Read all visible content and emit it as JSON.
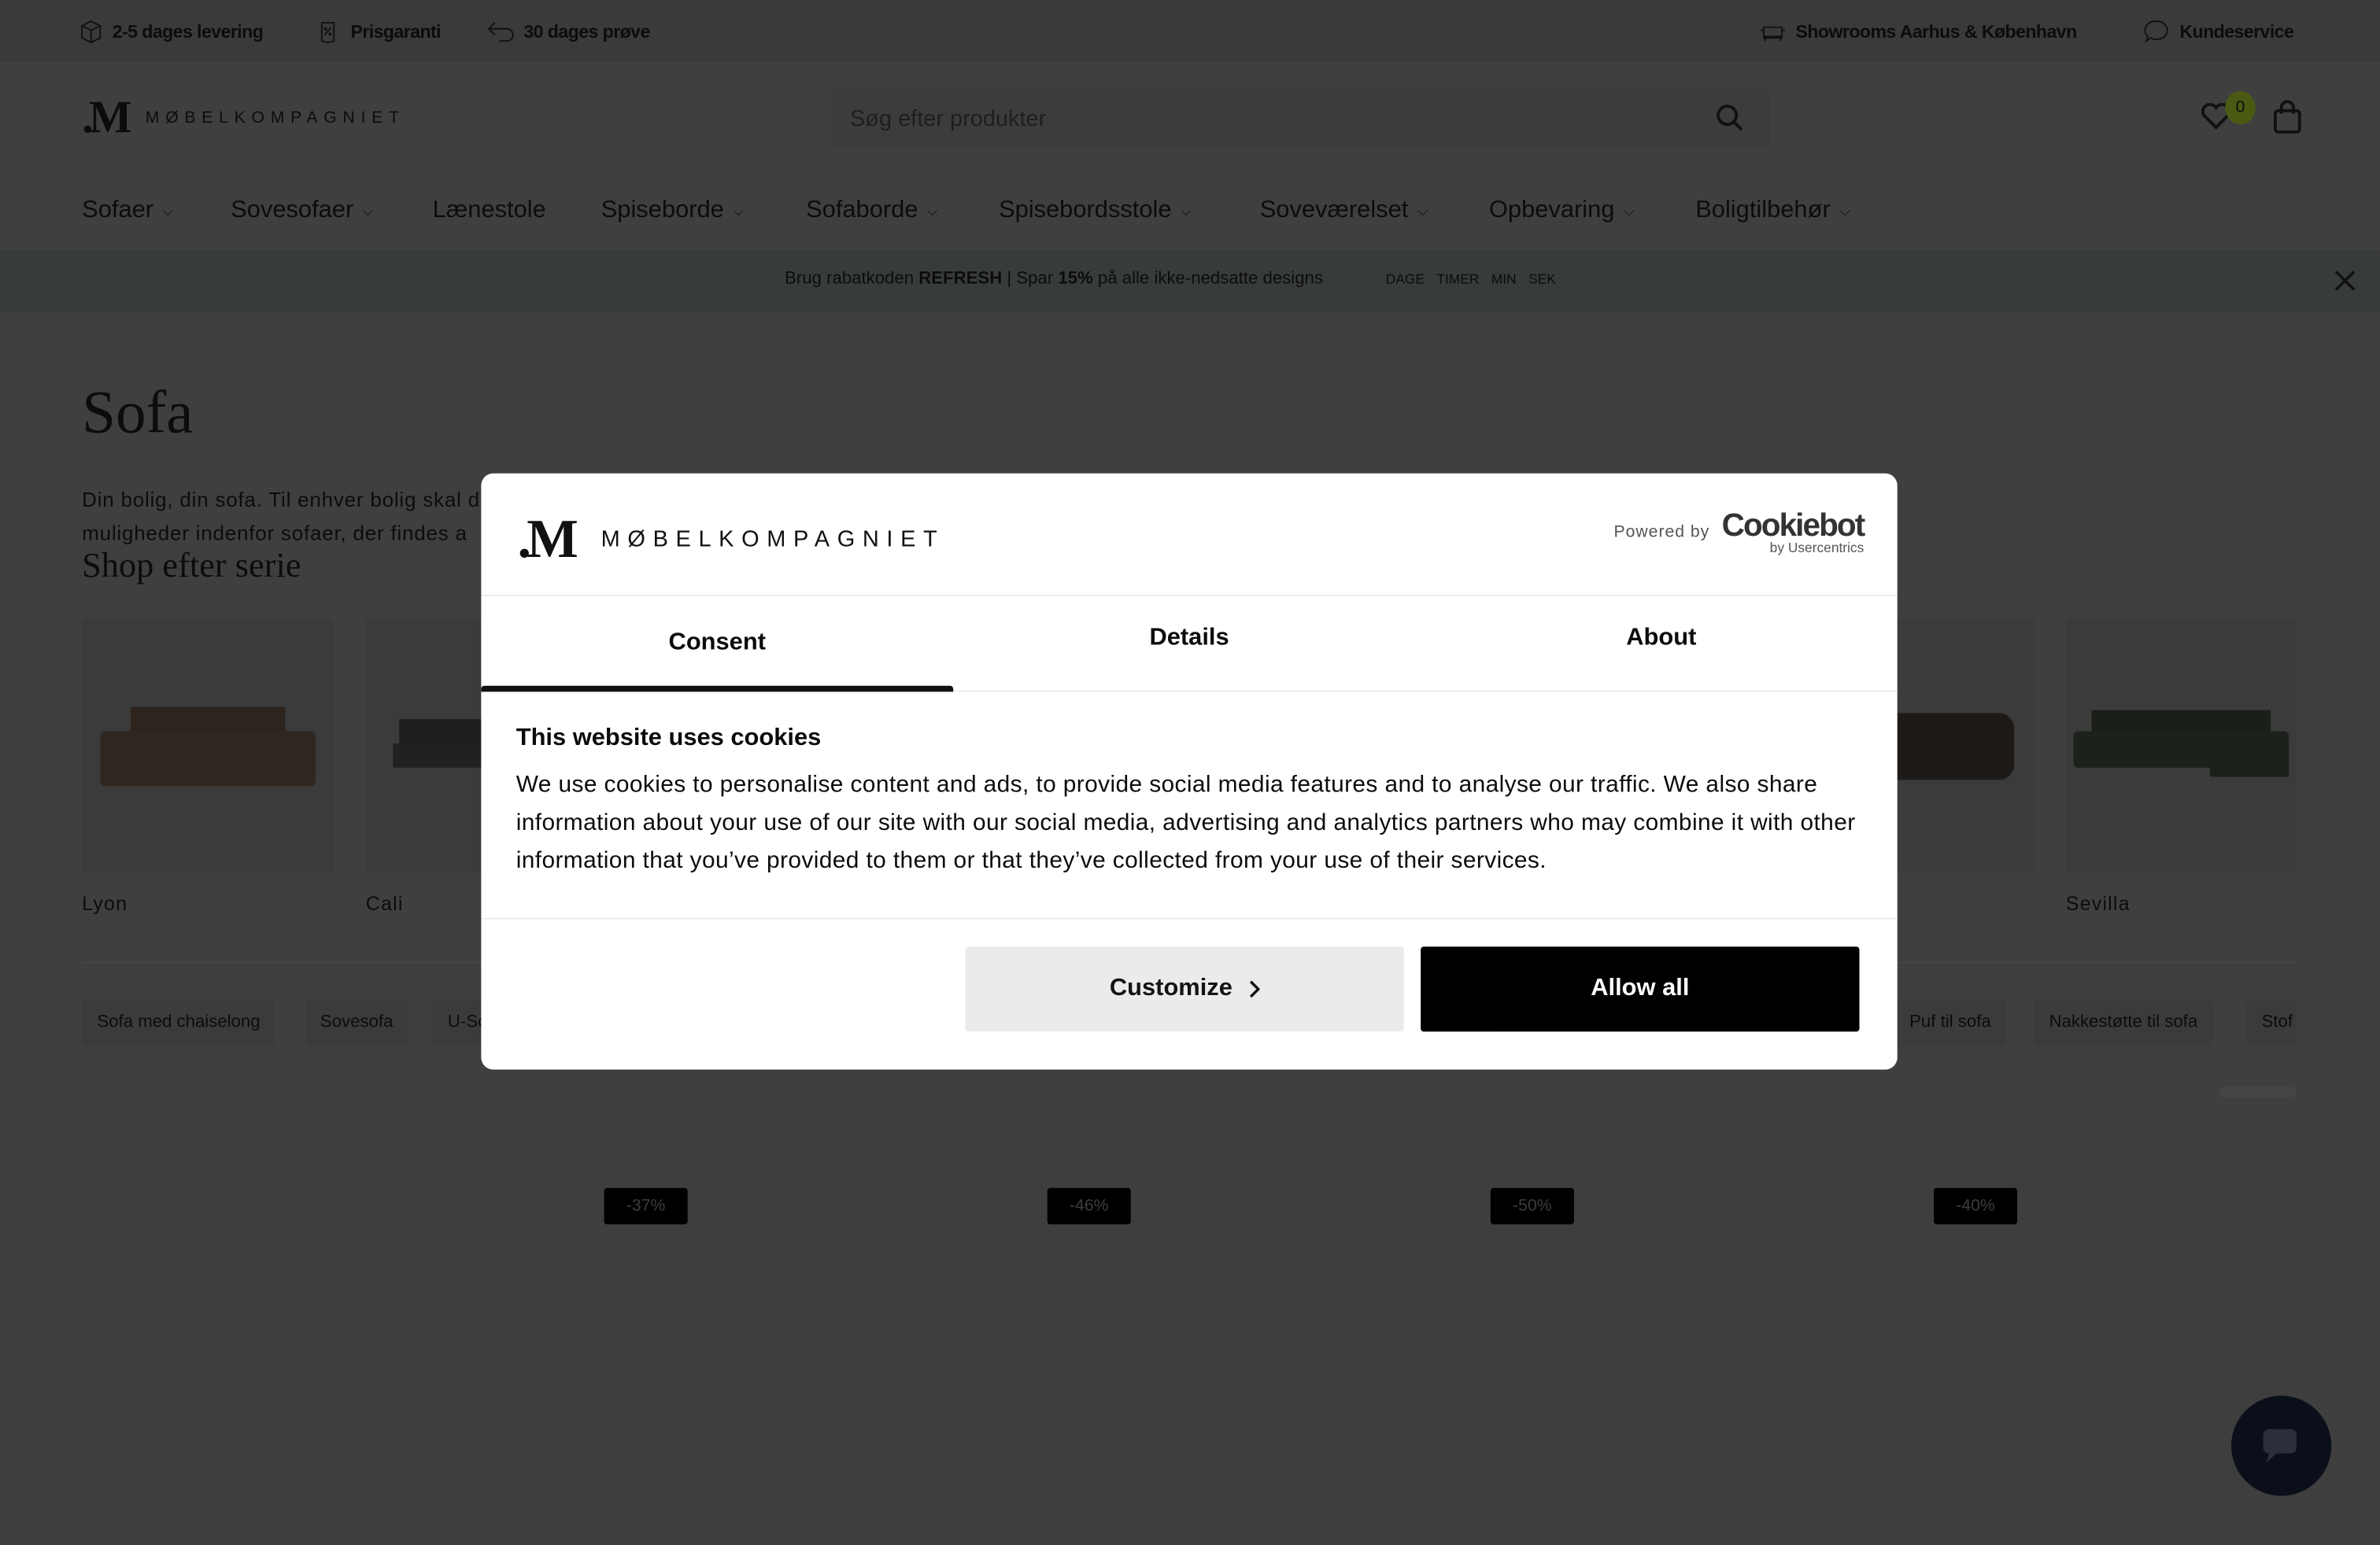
{
  "topbar": {
    "left": [
      {
        "icon": "box-icon",
        "label": "2-5 dages levering"
      },
      {
        "icon": "price-tag-icon",
        "label": "Prisgaranti"
      },
      {
        "icon": "return-arrow-icon",
        "label": "30 dages prøve"
      }
    ],
    "right": [
      {
        "icon": "sofa-icon",
        "label": "Showrooms Aarhus & København"
      },
      {
        "icon": "chat-bubble-icon",
        "label": "Kundeservice"
      }
    ]
  },
  "header": {
    "logo_mark": ".M",
    "logo_text": "MØBELKOMPAGNIET",
    "search_placeholder": "Søg efter produkter",
    "wishlist_count": "0",
    "badge_color": "#4a5a12"
  },
  "nav": [
    "Sofaer",
    "Sovesofaer",
    "Lænestole",
    "Spiseborde",
    "Sofaborde",
    "Spisebordsstole",
    "Soveværelset",
    "Opbevaring",
    "Boligtilbehør"
  ],
  "promo": {
    "prefix": "Brug rabatkoden ",
    "code": "REFRESH",
    "middle": " | Spar ",
    "percent": "15%",
    "suffix": " på alle ikke-nedsatte designs",
    "timer": [
      "DAGE",
      "TIMER",
      "MIN",
      "SEK"
    ]
  },
  "page": {
    "title": "Sofa",
    "description_line1": "Din bolig, din sofa. Til enhver bolig skal d",
    "description_line2": "muligheder indenfor sofaer, der findes a",
    "series_heading": "Shop efter serie",
    "series": [
      "Lyon",
      "Cali",
      "",
      "",
      "",
      "",
      "",
      "Sevilla"
    ],
    "chips": [
      "Sofa med chaiselong",
      "Sovesofa",
      "U-So",
      "Puf til sofa",
      "Nakkestøtte til sofa",
      "Stof"
    ],
    "discounts": [
      "-37%",
      "-46%",
      "-50%",
      "-40%"
    ]
  },
  "cookie": {
    "logo_mark": ".M",
    "logo_text": "MØBELKOMPAGNIET",
    "powered_by": "Powered by",
    "cookiebot": "Cookiebot",
    "cookiebot_sub": "by Usercentrics",
    "tabs": [
      "Consent",
      "Details",
      "About"
    ],
    "active_tab": "Consent",
    "title": "This website uses cookies",
    "text": "We use cookies to personalise content and ads, to provide social media features and to analyse our traffic. We also share information about your use of our site with our social media, advertising and analytics partners who may combine it with other information that you’ve provided to them or that they’ve collected from your use of their services.",
    "customize": "Customize",
    "allow_all": "Allow all"
  }
}
